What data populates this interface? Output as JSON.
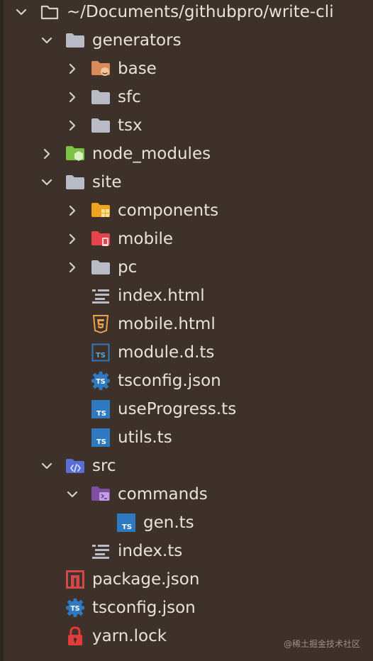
{
  "tree": {
    "root": {
      "label": "~/Documents/githubpro/write-cli",
      "icon": "folder-outline-icon",
      "expanded": true
    },
    "items": [
      {
        "label": "generators",
        "icon": "folder-icon",
        "expanded": true
      },
      {
        "label": "base",
        "icon": "folder-base-icon",
        "expanded": false
      },
      {
        "label": "sfc",
        "icon": "folder-icon",
        "expanded": false
      },
      {
        "label": "tsx",
        "icon": "folder-icon",
        "expanded": false
      },
      {
        "label": "node_modules",
        "icon": "folder-node-icon",
        "expanded": false
      },
      {
        "label": "site",
        "icon": "folder-icon",
        "expanded": true
      },
      {
        "label": "components",
        "icon": "folder-components-icon",
        "expanded": false
      },
      {
        "label": "mobile",
        "icon": "folder-mobile-icon",
        "expanded": false
      },
      {
        "label": "pc",
        "icon": "folder-icon",
        "expanded": false
      },
      {
        "label": "index.html",
        "icon": "html-lines-icon"
      },
      {
        "label": "mobile.html",
        "icon": "html5-icon"
      },
      {
        "label": "module.d.ts",
        "icon": "typescript-def-icon"
      },
      {
        "label": "tsconfig.json",
        "icon": "tsconfig-icon"
      },
      {
        "label": "useProgress.ts",
        "icon": "typescript-icon"
      },
      {
        "label": "utils.ts",
        "icon": "typescript-icon"
      },
      {
        "label": "src",
        "icon": "folder-src-icon",
        "expanded": true
      },
      {
        "label": "commands",
        "icon": "folder-commands-icon",
        "expanded": true
      },
      {
        "label": "gen.ts",
        "icon": "typescript-icon"
      },
      {
        "label": "index.ts",
        "icon": "index-lines-icon"
      },
      {
        "label": "package.json",
        "icon": "npm-icon"
      },
      {
        "label": "tsconfig.json",
        "icon": "tsconfig-icon"
      },
      {
        "label": "yarn.lock",
        "icon": "lock-icon"
      }
    ]
  },
  "watermark": "@稀土掘金技术社区",
  "colors": {
    "background": "#3d3129",
    "text": "#e7e2dc",
    "chevron": "#d6d0c9",
    "folder": "#b9bcc6",
    "typescript": "#2f79c0",
    "html5": "#e9a34a",
    "npm": "#d24848",
    "lock": "#e23b3b",
    "node": "#7cc244",
    "components": "#f0a31f",
    "mobile": "#e5454a",
    "src": "#5a6fd6",
    "commands": "#9b63c8",
    "base": "#d98a5a"
  }
}
